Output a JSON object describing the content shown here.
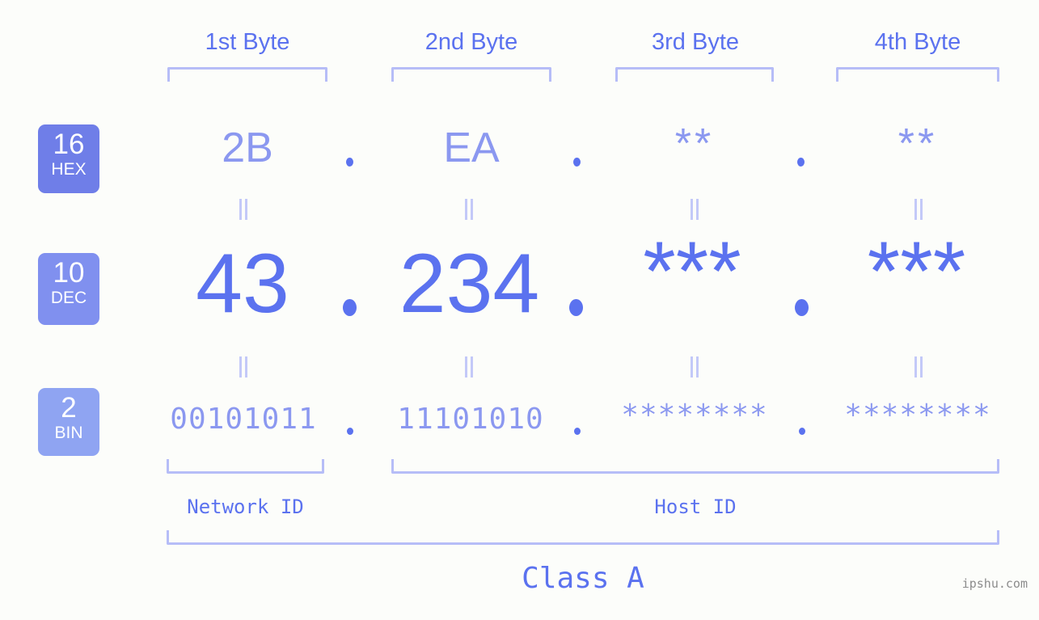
{
  "watermark": "ipshu.com",
  "byte_headers": [
    {
      "label": "1st Byte"
    },
    {
      "label": "2nd Byte"
    },
    {
      "label": "3rd Byte"
    },
    {
      "label": "4th Byte"
    }
  ],
  "rows": [
    {
      "base_number": "16",
      "base_name": "HEX",
      "values": [
        "2B",
        "EA",
        "**",
        "**"
      ],
      "separator": "."
    },
    {
      "base_number": "10",
      "base_name": "DEC",
      "values": [
        "43",
        "234",
        "***",
        "***"
      ],
      "separator": "."
    },
    {
      "base_number": "2",
      "base_name": "BIN",
      "values": [
        "00101011",
        "11101010",
        "********",
        "********"
      ],
      "separator": "."
    }
  ],
  "equals_marks": [
    "=",
    "=",
    "=",
    "=",
    "=",
    "=",
    "=",
    "="
  ],
  "id_sections": [
    {
      "label": "Network ID"
    },
    {
      "label": "Host ID"
    }
  ],
  "class_label": "Class A",
  "colors": {
    "background": "#fcfdfa",
    "primary": "#5b72ef",
    "light": "#8b98f0",
    "bracket": "#b6bdf7",
    "badge_hex": "#6f7ee8",
    "badge_dec": "#8090ef",
    "badge_bin": "#8fa4f2",
    "watermark": "#8c8c8c"
  }
}
